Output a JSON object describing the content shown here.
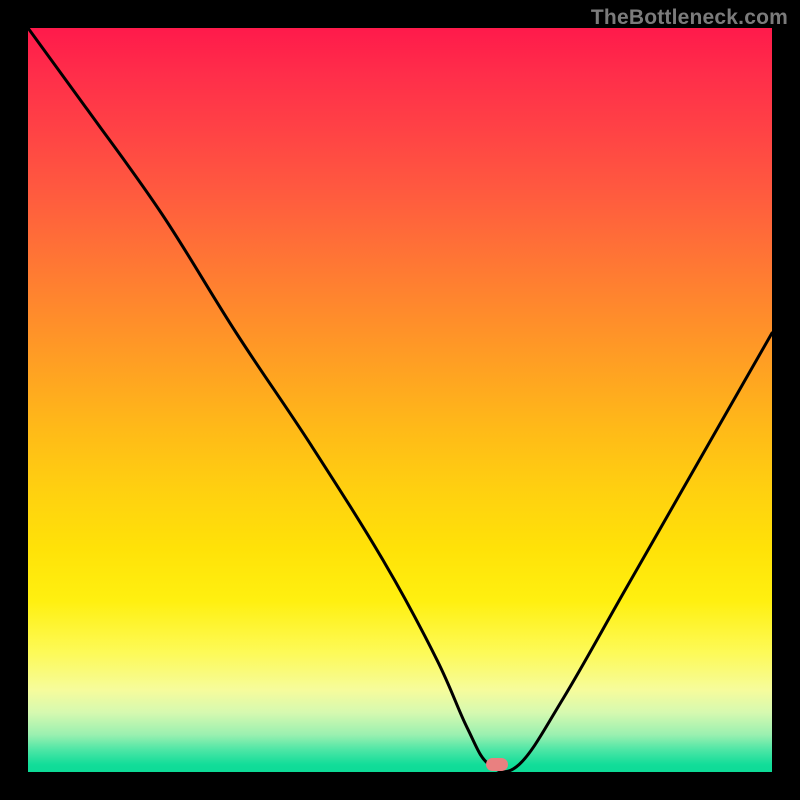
{
  "watermark": "TheBottleneck.com",
  "marker": {
    "x_pct": 63,
    "y_pct": 99
  },
  "chart_data": {
    "type": "line",
    "title": "",
    "xlabel": "",
    "ylabel": "",
    "xlim": [
      0,
      100
    ],
    "ylim": [
      0,
      100
    ],
    "background": "red-yellow-green vertical gradient",
    "series": [
      {
        "name": "bottleneck-curve",
        "x": [
          0,
          8,
          18,
          28,
          38,
          48,
          55,
          59,
          62,
          66,
          72,
          80,
          88,
          96,
          100
        ],
        "y": [
          100,
          89,
          75,
          59,
          44,
          28,
          15,
          6,
          1,
          1,
          10,
          24,
          38,
          52,
          59
        ]
      }
    ],
    "marker_points": [
      {
        "name": "optimum",
        "x": 63,
        "y": 1
      }
    ],
    "gradient_stops": [
      {
        "pct": 0,
        "color": "#ff1a4b"
      },
      {
        "pct": 50,
        "color": "#ffba18"
      },
      {
        "pct": 85,
        "color": "#fdfa58"
      },
      {
        "pct": 100,
        "color": "#0ddb97"
      }
    ]
  }
}
